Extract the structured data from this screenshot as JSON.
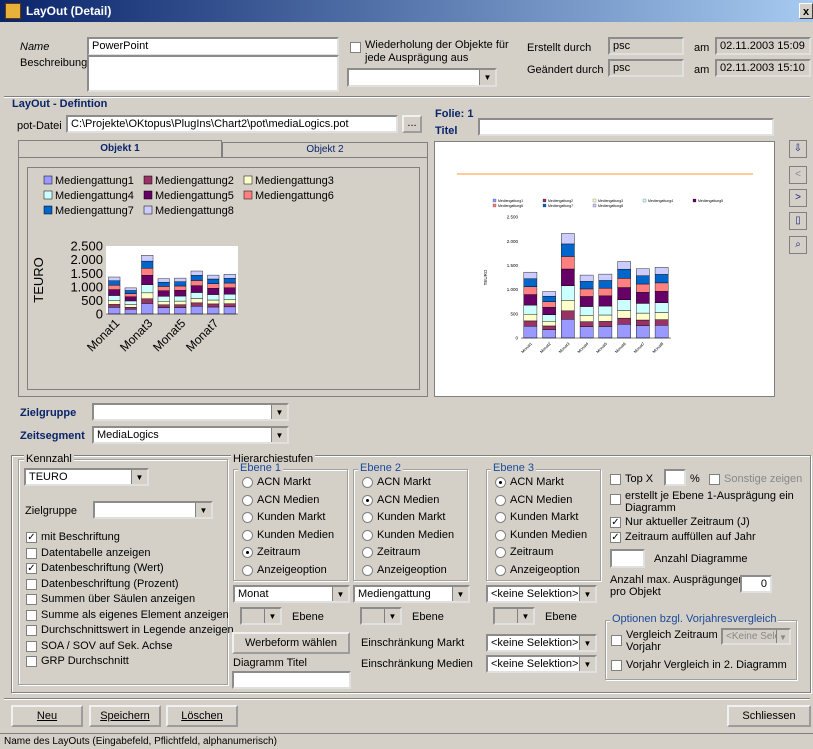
{
  "window": {
    "title": "LayOut (Detail)",
    "close": "x"
  },
  "header": {
    "name_label": "Name",
    "name_value": "PowerPoint",
    "beschreibung_label": "Beschreibung",
    "wiederholung_label_1": "Wiederholung der Objekte für",
    "wiederholung_label_2": "jede Ausprägung aus",
    "erstellt_label": "Erstellt durch",
    "erstellt_value": "psc",
    "am_label": "am",
    "erstellt_date": "02.11.2003 15:09",
    "geaendert_label": "Geändert durch",
    "geaendert_value": "psc",
    "geaendert_date": "02.11.2003 15:10"
  },
  "layout_def": {
    "section_label": "LayOut - Defintion",
    "pot_label": "pot-Datei",
    "pot_value": "C:\\Projekte\\OKtopus\\PlugIns\\Chart2\\pot\\mediaLogics.pot",
    "browse": "...",
    "folie_label": "Folie: 1",
    "titel_label": "Titel",
    "tab1": "Objekt 1",
    "tab2": "Objekt 2"
  },
  "zielgruppe_label": "Zielgruppe",
  "zeitsegment_label": "Zeitsegment",
  "zeitsegment_value": "MediaLogics",
  "kennzahl": {
    "title": "Kennzahl",
    "value": "TEURO",
    "zielgruppe_label": "Zielgruppe",
    "checks": [
      {
        "label": "mit Beschriftung",
        "checked": true
      },
      {
        "label": "Datentabelle anzeigen",
        "checked": false
      },
      {
        "label": "Datenbeschriftung (Wert)",
        "checked": true
      },
      {
        "label": "Datenbeschriftung (Prozent)",
        "checked": false
      },
      {
        "label": "Summen über Säulen anzeigen",
        "checked": false
      },
      {
        "label": "Summe als eigenes Element anzeigen",
        "checked": false
      },
      {
        "label": "Durchschnittswert in Legende anzeigen",
        "checked": false
      },
      {
        "label": "SOA / SOV auf Sek. Achse",
        "checked": false
      },
      {
        "label": "GRP Durchschnitt",
        "checked": false
      }
    ]
  },
  "hierarchie": {
    "title": "Hierarchiestufen",
    "ebenen": [
      {
        "title": "Ebene 1",
        "selected": "Zeitraum",
        "dropdown": "Monat"
      },
      {
        "title": "Ebene 2",
        "selected": "ACN Medien",
        "dropdown": "Mediengattung"
      },
      {
        "title": "Ebene 3",
        "selected": "ACN Markt",
        "dropdown": "<keine Selektion>"
      }
    ],
    "options": [
      "ACN Markt",
      "ACN Medien",
      "Kunden Markt",
      "Kunden Medien",
      "Zeitraum",
      "Anzeigeoption"
    ],
    "ebene_label": "Ebene",
    "werbeform_button": "Werbeform wählen",
    "diagramm_titel_label": "Diagramm Titel",
    "einschr_markt_label": "Einschränkung Markt",
    "einschr_medien_label": "Einschränkung Medien",
    "einschr_markt_value": "<keine Selektion>",
    "einschr_medien_value": "<keine Selektion>"
  },
  "right_opts": {
    "top_label": "Top X",
    "percent": "%",
    "sonstige": "Sonstige zeigen",
    "erstellt_label_1": "erstellt je Ebene 1-Ausprägung ein",
    "erstellt_label_2": "Diagramm",
    "nur_aktuell": "Nur aktueller Zeitraum (J)",
    "auffuellen": "Zeitraum auffüllen auf Jahr",
    "anzahl_diagramme": "Anzahl Diagramme",
    "anzahl_max_1": "Anzahl max. Ausprägungen",
    "anzahl_max_2": "pro Objekt",
    "anzahl_max_value": "0",
    "vorjahr_title": "Optionen bzgl. Vorjahresvergleich",
    "vergleich_1": "Vergleich Zeitraum",
    "vergleich_2": "Vorjahr",
    "keine_sele": "<Keine Sele",
    "vorjahr_2": "Vorjahr Vergleich in 2. Diagramm"
  },
  "footer": {
    "neu": "Neu",
    "speichern": "Speichern",
    "loeschen": "Löschen",
    "schliessen": "Schliessen"
  },
  "status": "Name des LayOuts (Eingabefeld, Pflichtfeld, alphanumerisch)",
  "chart_data": {
    "type": "bar",
    "legend": [
      "Mediengattung1",
      "Mediengattung2",
      "Mediengattung3",
      "Mediengattung4",
      "Mediengattung5",
      "Mediengattung6",
      "Mediengattung7",
      "Mediengattung8"
    ],
    "colors": [
      "#9999ff",
      "#993366",
      "#ffffcc",
      "#ccffff",
      "#660066",
      "#ff8080",
      "#0066cc",
      "#ccccff"
    ],
    "ylabel": "TEURO",
    "yticks": [
      "0",
      "500",
      "1.000",
      "1.500",
      "2.000",
      "2.500"
    ],
    "ylim": [
      0,
      2500
    ],
    "categories": [
      "Monat1",
      "Monat2",
      "Monat3",
      "Monat4",
      "Monat5",
      "Monat6",
      "Monat7",
      "Monat8"
    ],
    "xticks": [
      "Monat1",
      "Monat3",
      "Monat5",
      "Monat7"
    ],
    "totals": [
      1360,
      960,
      2160,
      1300,
      1320,
      1580,
      1430,
      1460
    ]
  }
}
